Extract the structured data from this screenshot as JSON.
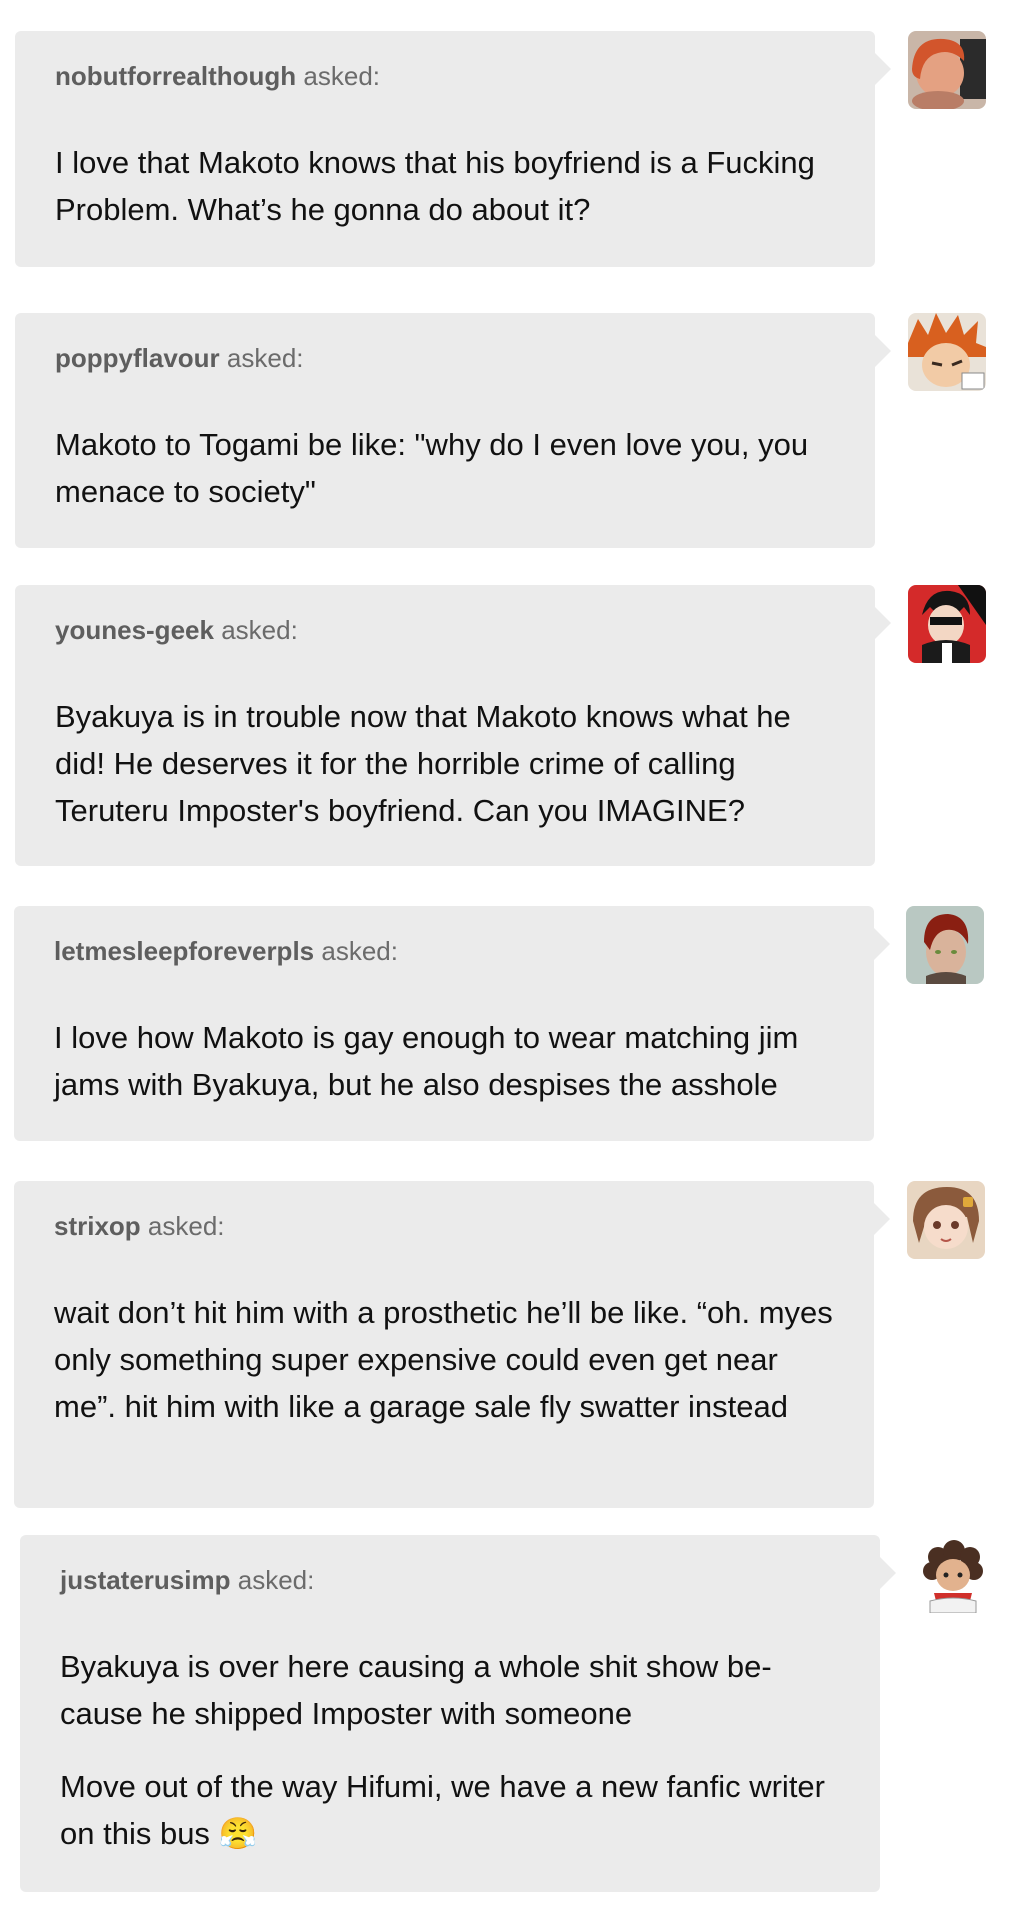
{
  "asks": [
    {
      "username": "nobutforrealthough",
      "asked_label": "asked:",
      "paragraphs": [
        "I love that Makoto knows that his boyfriend is a Fucking Problem. What’s he gonna do about it?"
      ],
      "avatar_icon": "avatar-red-hair-girl"
    },
    {
      "username": "poppyflavour",
      "asked_label": "asked:",
      "paragraphs": [
        "Makoto to Togami be like: \"why do I even love you, you menace to society\""
      ],
      "avatar_icon": "avatar-orange-spiky-hair"
    },
    {
      "username": "younes-geek",
      "asked_label": "asked:",
      "paragraphs": [
        "Byakuya is in trouble now that Makoto knows what he did! He deserves it for the horrible crime of calling Teruteru Imposter's boyfriend. Can you IMAGINE?"
      ],
      "avatar_icon": "avatar-masked-character"
    },
    {
      "username": "letmesleepforeverpls",
      "asked_label": "asked:",
      "paragraphs": [
        "I love how Makoto is gay enough to wear matching jim jams with Byakuya, but he also despises the asshole"
      ],
      "avatar_icon": "avatar-red-hair-boy"
    },
    {
      "username": "strixop",
      "asked_label": "asked:",
      "paragraphs": [
        "wait don’t hit him with a prosthetic he’ll be like. “oh. myes only something super expensive could even get near me”. hit him with like a garage sale fly swatter instead"
      ],
      "avatar_icon": "avatar-anime-girl"
    },
    {
      "username": "justaterusimp",
      "asked_label": "asked:",
      "paragraphs": [
        "Byakuya is over here causing a whole shit show be-cause he shipped Imposter with someone",
        "Move out of the way Hifumi, we have a new fanfic writer on this bus 😤"
      ],
      "avatar_icon": "avatar-curly-hair-chef"
    }
  ],
  "colors": {
    "bubble_bg": "#ebebeb",
    "username": "#5e5e5e",
    "asked_label": "#6b6b6b",
    "message_text": "#111111"
  }
}
